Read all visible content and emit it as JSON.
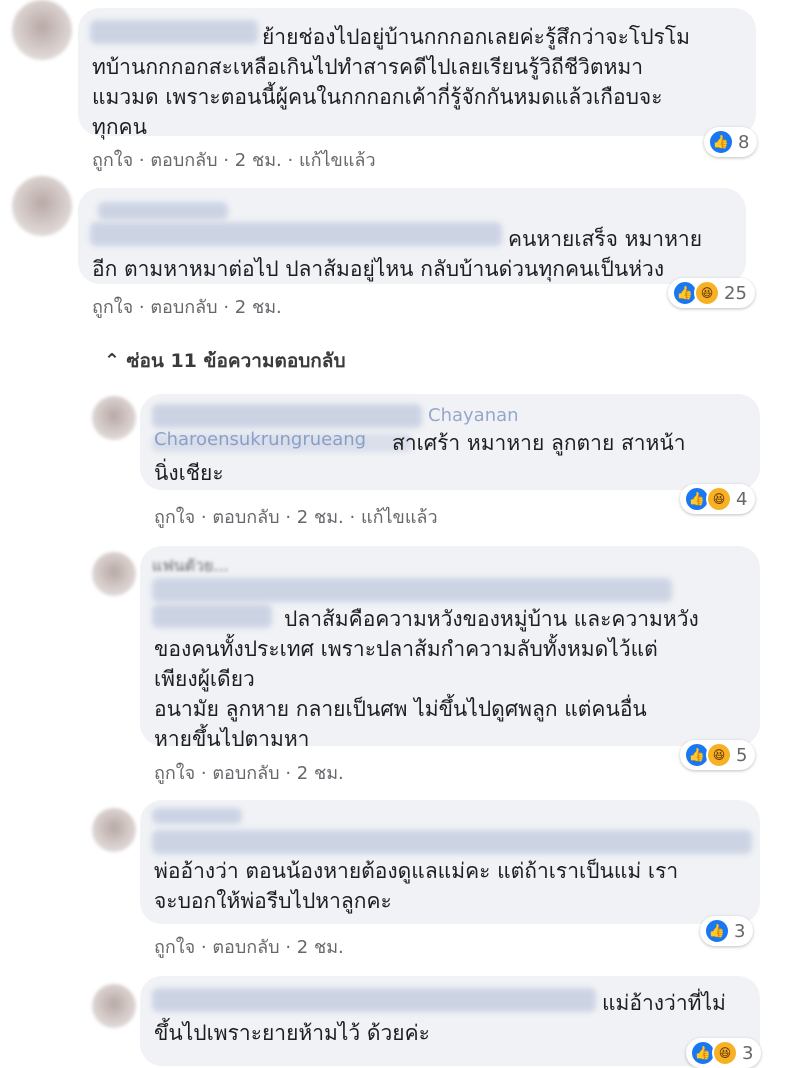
{
  "comments": [
    {
      "text": "ย้ายช่องไปอยู่บ้านกกกอกเลยค่ะรู้สึกว่าจะโปรโม\nทบ้านกกกอกสะเหลือเกินไปทำสารคดีไปเลยเรียนรู้วิถีชีวิตหมา\nแมวมด เพราะตอนนี้ผู้คนในกกกอกเค้ากี่รู้จักกันหมดแล้วเกือบจะ\nทุกคน",
      "like": "ถูกใจ",
      "reply": "ตอบกลับ",
      "time": "2 ชม.",
      "edited": "แก้ไขแล้ว",
      "reaction_count": "8"
    },
    {
      "text": "คนหายเสร็จ หมาหาย\nอีก ตามหาหมาต่อไป ปลาส้มอยู่ไหน กลับบ้านด่วนทุกคนเป็นห่วง",
      "like": "ถูกใจ",
      "reply": "ตอบกลับ",
      "time": "2 ชม.",
      "reaction_count": "25"
    }
  ],
  "hide_replies": "ซ่อน 11 ข้อความตอบกลับ",
  "replies": [
    {
      "name_visible": "Chayanan\nCharoensukrungrueang",
      "text": "สาเศร้า หมาหาย ลูกตาย สาหน้า\nนิ่งเชียะ",
      "like": "ถูกใจ",
      "reply": "ตอบกลับ",
      "time": "2 ชม.",
      "edited": "แก้ไขแล้ว",
      "reaction_count": "4"
    },
    {
      "badge": "แฟนตัวย...",
      "text": "ปลาส้มคือความหวังของหมู่บ้าน และความหวัง\nของคนทั้งประเทศ เพราะปลาส้มกำความลับทั้งหมดไว้แต่\nเพียงผู้เดียว\nอนามัย ลูกหาย กลายเป็นศพ ไม่ขึ้นไปดูศพลูก แต่คนอื่น\nหายขึ้นไปตามหา",
      "like": "ถูกใจ",
      "reply": "ตอบกลับ",
      "time": "2 ชม.",
      "reaction_count": "5"
    },
    {
      "text": "พ่ออ้างว่า ตอนน้องหายต้องดูแลแม่คะ แต่ถ้าเราเป็นแม่ เรา\nจะบอกให้พ่อรีบไปหาลูกคะ",
      "like": "ถูกใจ",
      "reply": "ตอบกลับ",
      "time": "2 ชม.",
      "reaction_count": "3"
    },
    {
      "text": "แม่อ้างว่าที่ไม่\nขึ้นไปเพราะยายห้ามไว้ ด้วยค่ะ",
      "reaction_count": "3"
    }
  ],
  "separator": "·",
  "icons": {
    "like": "thumbs-up-icon",
    "haha": "laughing-face-icon",
    "chevron": "chevron-up-icon"
  },
  "colors": {
    "like_blue": "#1877f2",
    "haha_yellow": "#f7b125",
    "bubble": "#f0f2f5",
    "meta": "#65676b"
  }
}
